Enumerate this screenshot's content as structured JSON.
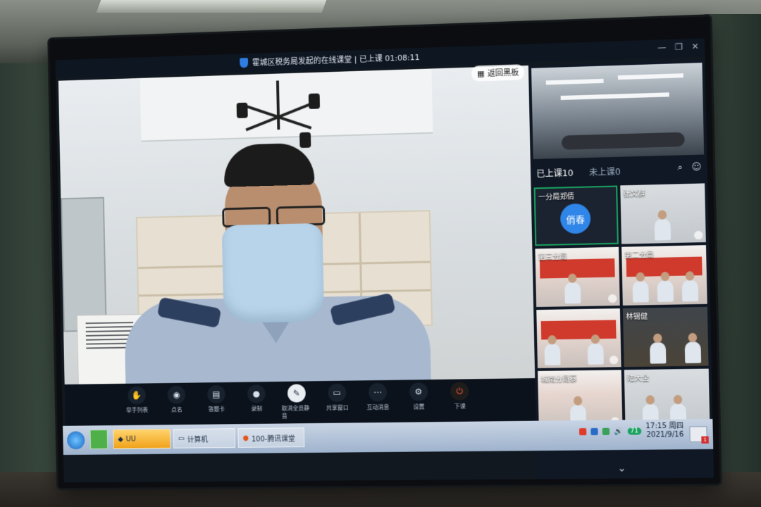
{
  "app": {
    "title": "霍城区税务局发起的在线课堂 | 已上课 01:08:11",
    "board_button": "返回黑板",
    "window_controls": [
      "—",
      "❐",
      "✕"
    ]
  },
  "right_panel": {
    "tabs": [
      {
        "label": "已上课10"
      },
      {
        "label": "未上课0"
      }
    ],
    "tiles": [
      {
        "name": "一分局郑倩",
        "avatar_text": "俏春",
        "active": true
      },
      {
        "name": "张文群"
      },
      {
        "name": "第三分局"
      },
      {
        "name": "第二分局"
      },
      {
        "name": ""
      },
      {
        "name": "林锡健"
      },
      {
        "name": "城南分局蔡"
      },
      {
        "name": "陆大全"
      }
    ]
  },
  "toolbar": {
    "items": [
      {
        "label": "举手列表",
        "icon": "hand-icon"
      },
      {
        "label": "点名",
        "icon": "pin-icon"
      },
      {
        "label": "答题卡",
        "icon": "card-icon"
      },
      {
        "label": "录制",
        "icon": "record-icon"
      },
      {
        "label": "取消全员静音",
        "icon": "mic-icon"
      },
      {
        "label": "共享窗口",
        "icon": "share-icon"
      },
      {
        "label": "互动消息",
        "icon": "chat-icon"
      },
      {
        "label": "设置",
        "icon": "gear-icon"
      },
      {
        "label": "下课",
        "icon": "power-icon"
      }
    ]
  },
  "taskbar": {
    "tasks": [
      {
        "label": "",
        "style": "green"
      },
      {
        "label": "UU",
        "style": "orange"
      },
      {
        "label": "计算机",
        "style": "normal"
      },
      {
        "label": "100-腾讯课堂",
        "style": "normal"
      }
    ],
    "tray_badge": "71",
    "time": "17:15 周四",
    "date": "2021/9/16",
    "notify_count": "1"
  },
  "colors": {
    "accent_blue": "#2f86e8",
    "active_green": "#1aa260",
    "danger": "#ff5a3c"
  }
}
